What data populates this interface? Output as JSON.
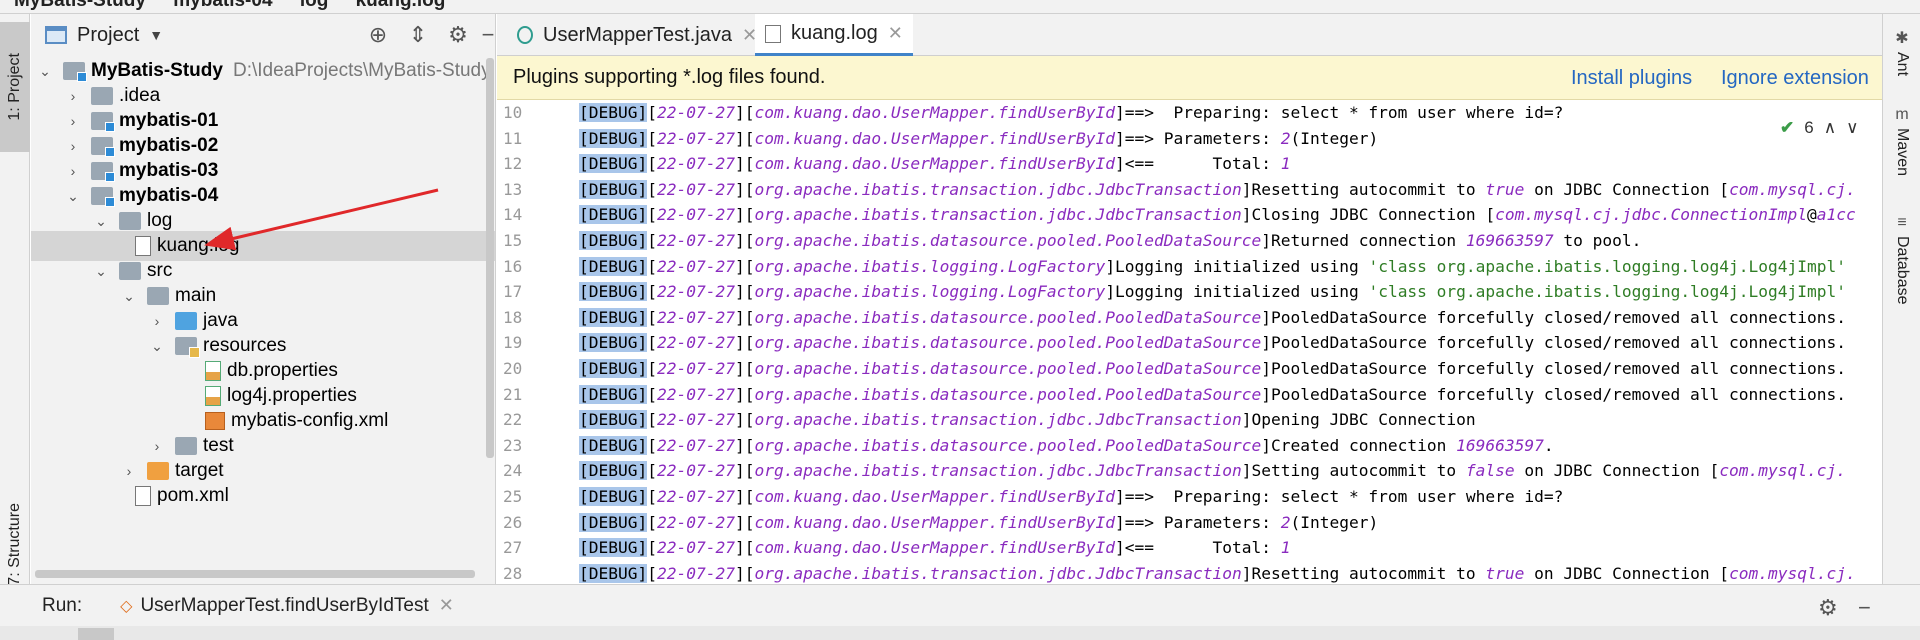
{
  "top_breadcrumb": [
    "MyBatis-Study",
    "mybatis-04",
    "log",
    "kuang.log"
  ],
  "left_strip": {
    "project_tab": "1: Project",
    "structure_tab": "7: Structure"
  },
  "right_strip": {
    "ant": "Ant",
    "maven": "Maven",
    "database": "Database"
  },
  "project_panel": {
    "title": "Project",
    "tree": [
      {
        "label": "MyBatis-Study",
        "path": "D:\\IdeaProjects\\MyBatis-Study",
        "bold": true
      },
      {
        "label": ".idea"
      },
      {
        "label": "mybatis-01",
        "bold": true
      },
      {
        "label": "mybatis-02",
        "bold": true
      },
      {
        "label": "mybatis-03",
        "bold": true
      },
      {
        "label": "mybatis-04",
        "bold": true
      },
      {
        "label": "log"
      },
      {
        "label": "kuang.log"
      },
      {
        "label": "src"
      },
      {
        "label": "main"
      },
      {
        "label": "java"
      },
      {
        "label": "resources"
      },
      {
        "label": "db.properties"
      },
      {
        "label": "log4j.properties"
      },
      {
        "label": "mybatis-config.xml"
      },
      {
        "label": "test"
      },
      {
        "label": "target"
      },
      {
        "label": "pom.xml"
      }
    ]
  },
  "editor": {
    "tabs": [
      {
        "label": "UserMapperTest.java"
      },
      {
        "label": "kuang.log"
      }
    ],
    "banner": {
      "message": "Plugins supporting *.log files found.",
      "install": "Install plugins",
      "ignore": "Ignore extension"
    },
    "inspection_count": "6",
    "line_numbers": [
      "10",
      "11",
      "12",
      "13",
      "14",
      "15",
      "16",
      "17",
      "18",
      "19",
      "20",
      "21",
      "22",
      "23",
      "24",
      "25",
      "26",
      "27",
      "28"
    ]
  },
  "run_bar": {
    "label": "Run:",
    "tab": "UserMapperTest.findUserByIdTest"
  },
  "colors": {
    "accent": "#4083c9",
    "banner_bg": "#fcf7d0",
    "link": "#2467c2",
    "italic_purple": "#8a2bbf",
    "string_green": "#2f7d25",
    "selection": "#a9c6ea",
    "annotation_arrow": "#e0282a"
  }
}
